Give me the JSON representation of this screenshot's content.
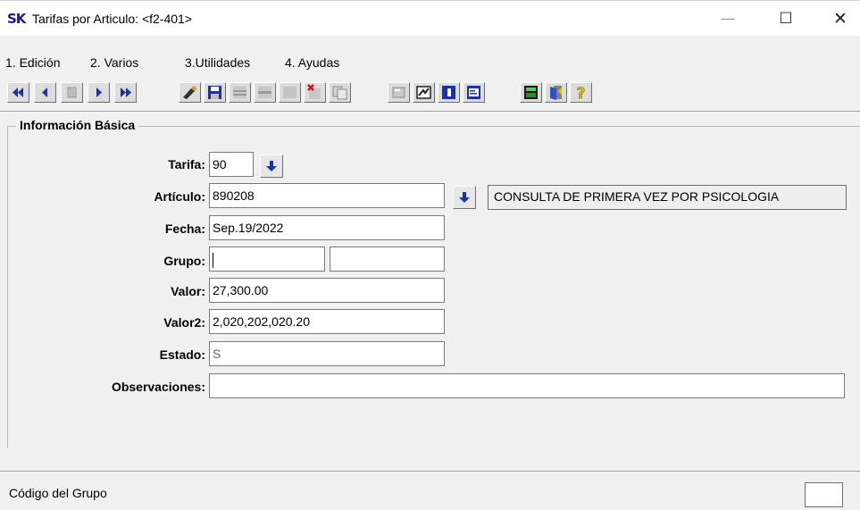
{
  "window": {
    "logo": "SK",
    "title": "Tarifas por Articulo: <f2-401>",
    "minimize": "—",
    "maximize": "☐",
    "close": "✕"
  },
  "menu": [
    "1. Edición",
    "2. Varios",
    "3.Utilidades",
    "4. Ayudas"
  ],
  "toolbar": {
    "buttons": [
      "first-record-icon",
      "previous-record-icon",
      "stop-icon",
      "next-record-icon",
      "last-record-icon",
      "edit-icon",
      "save-icon",
      "insert-row-icon",
      "delete-row-icon",
      "blank-icon",
      "cancel-icon",
      "copy-icon",
      "print-icon",
      "report-icon",
      "book-icon",
      "form-icon",
      "calculator-icon",
      "exit-door-icon",
      "help-icon"
    ]
  },
  "form": {
    "group_title": "Información Básica",
    "tarifa": {
      "label": "Tarifa:",
      "value": "90"
    },
    "articulo": {
      "label": "Artículo:",
      "value": "890208",
      "description": "CONSULTA DE PRIMERA VEZ POR PSICOLOGIA"
    },
    "fecha": {
      "label": "Fecha:",
      "value": "Sep.19/2022"
    },
    "grupo": {
      "label": "Grupo:",
      "value1": "",
      "value2": ""
    },
    "valor": {
      "label": "Valor:",
      "value": "27,300.00"
    },
    "valor2": {
      "label": "Valor2:",
      "value": "2,020,202,020.20"
    },
    "estado": {
      "label": "Estado:",
      "value": "S"
    },
    "observaciones": {
      "label": "Observaciones:",
      "value": ""
    }
  },
  "status": {
    "text": "Código del Grupo",
    "panel": ""
  },
  "colors": {
    "background": "#f0f0f0",
    "nav_blue": "#1c33a8",
    "field_border": "#7a7a7a"
  }
}
